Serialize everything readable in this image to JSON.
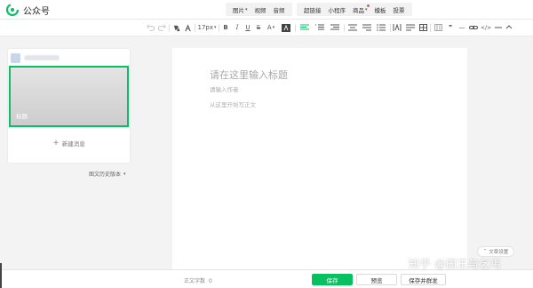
{
  "header": {
    "app_name": "公众号",
    "insert_group_1": [
      {
        "label": "图片",
        "caret": "▾"
      },
      {
        "label": "视频"
      },
      {
        "label": "音频"
      }
    ],
    "insert_group_2": [
      {
        "label": "超链接"
      },
      {
        "label": "小程序"
      },
      {
        "label": "商品",
        "caret": "▾",
        "dot": true
      },
      {
        "label": "模板"
      },
      {
        "label": "投票"
      }
    ]
  },
  "toolbar": {
    "font_size": "17px",
    "bold": "B",
    "italic": "I",
    "underline": "U",
    "strikethrough": "S",
    "font_color": "A",
    "quote": "❞",
    "divider_icon": "—",
    "link_icon": "</>"
  },
  "sidebar": {
    "article_cover_title": "标题",
    "new_message": "新建消息",
    "history_versions": "图文历史版本"
  },
  "editor": {
    "title_placeholder": "请在这里输入标题",
    "author_placeholder": "请输入作者",
    "body_placeholder": "从这里开始写正文"
  },
  "settings_button": "文章设置",
  "bottom": {
    "word_count_label": "正文字数",
    "word_count_value": "0",
    "save": "保存",
    "preview": "预览",
    "save_and_publish": "保存并群发"
  },
  "watermark": "知乎 @国王与乞丐",
  "colors": {
    "accent": "#07c160",
    "badge": "#fa5151"
  }
}
